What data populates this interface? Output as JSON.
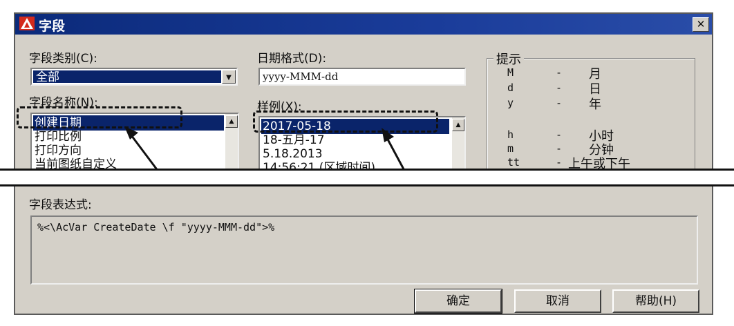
{
  "window": {
    "title": "字段",
    "close_label": "✕"
  },
  "field_category": {
    "label": "字段类别(C):",
    "value": "全部"
  },
  "field_names": {
    "label": "字段名称(N):",
    "items": [
      "创建日期",
      "打印比例",
      "打印方向",
      "当前图纸自定义"
    ]
  },
  "date_format": {
    "label": "日期格式(D):",
    "value": "yyyy-MMM-dd"
  },
  "examples": {
    "label": "样例(X):",
    "items": [
      "2017-05-18",
      "18-五月-17",
      "5.18.2013",
      "14:56:21 (区域时间)"
    ]
  },
  "hints": {
    "title": "提示",
    "rows": [
      {
        "code": "M",
        "dash": "-",
        "meaning": "月"
      },
      {
        "code": "d",
        "dash": "-",
        "meaning": "日"
      },
      {
        "code": "y",
        "dash": "-",
        "meaning": "年"
      },
      {
        "code": "h",
        "dash": "-",
        "meaning": "小时"
      },
      {
        "code": "m",
        "dash": "-",
        "meaning": "分钟"
      },
      {
        "code": "tt",
        "dash": "-",
        "meaning": "上午或下午"
      }
    ]
  },
  "expression": {
    "label": "字段表达式:",
    "value": "%<\\AcVar CreateDate \\f \"yyyy-MMM-dd\">%"
  },
  "buttons": {
    "ok": "确定",
    "cancel": "取消",
    "help": "帮助(H)"
  },
  "colors": {
    "titlebar": "#0b2a7a",
    "selection": "#0a246a",
    "dialog_bg": "#d4d0c8"
  }
}
